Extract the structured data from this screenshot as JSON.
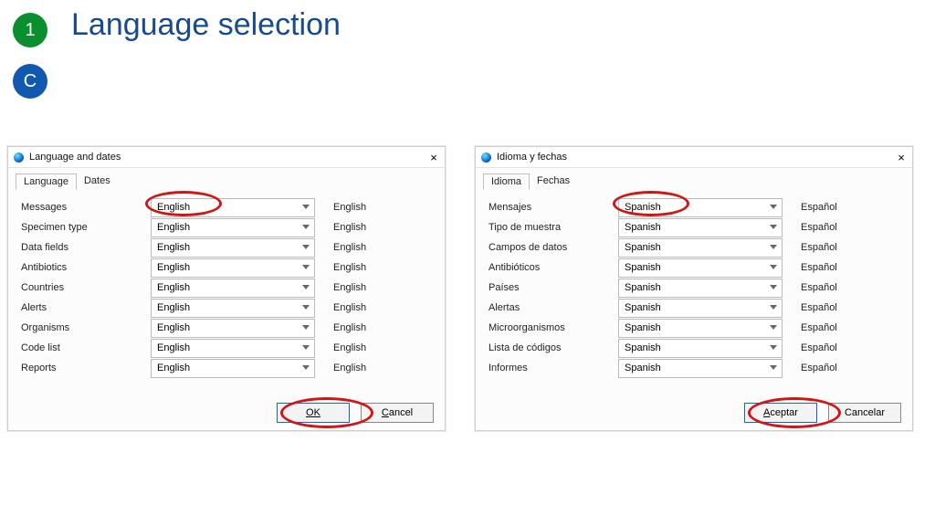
{
  "header": {
    "step_number": "1",
    "badge_letter": "C",
    "title": "Language selection"
  },
  "dialogs": [
    {
      "key": "en",
      "window_title": "Language and dates",
      "tabs": [
        "Language",
        "Dates"
      ],
      "active_tab": 0,
      "rows": [
        {
          "label": "Messages",
          "value": "English",
          "display": "English"
        },
        {
          "label": "Specimen type",
          "value": "English",
          "display": "English"
        },
        {
          "label": "Data fields",
          "value": "English",
          "display": "English"
        },
        {
          "label": "Antibiotics",
          "value": "English",
          "display": "English"
        },
        {
          "label": "Countries",
          "value": "English",
          "display": "English"
        },
        {
          "label": "Alerts",
          "value": "English",
          "display": "English"
        },
        {
          "label": "Organisms",
          "value": "English",
          "display": "English"
        },
        {
          "label": "Code list",
          "value": "English",
          "display": "English"
        },
        {
          "label": "Reports",
          "value": "English",
          "display": "English"
        }
      ],
      "buttons": {
        "ok": "OK",
        "cancel": "Cancel"
      }
    },
    {
      "key": "es",
      "window_title": "Idioma y fechas",
      "tabs": [
        "Idioma",
        "Fechas"
      ],
      "active_tab": 0,
      "rows": [
        {
          "label": "Mensajes",
          "value": "Spanish",
          "display": "Español"
        },
        {
          "label": "Tipo de muestra",
          "value": "Spanish",
          "display": "Español"
        },
        {
          "label": "Campos de datos",
          "value": "Spanish",
          "display": "Español"
        },
        {
          "label": "Antibióticos",
          "value": "Spanish",
          "display": "Español"
        },
        {
          "label": "Países",
          "value": "Spanish",
          "display": "Español"
        },
        {
          "label": "Alertas",
          "value": "Spanish",
          "display": "Español"
        },
        {
          "label": "Microorganismos",
          "value": "Spanish",
          "display": "Español"
        },
        {
          "label": "Lista de códigos",
          "value": "Spanish",
          "display": "Español"
        },
        {
          "label": "Informes",
          "value": "Spanish",
          "display": "Español"
        }
      ],
      "buttons": {
        "ok": "Aceptar",
        "cancel": "Cancelar"
      }
    }
  ]
}
